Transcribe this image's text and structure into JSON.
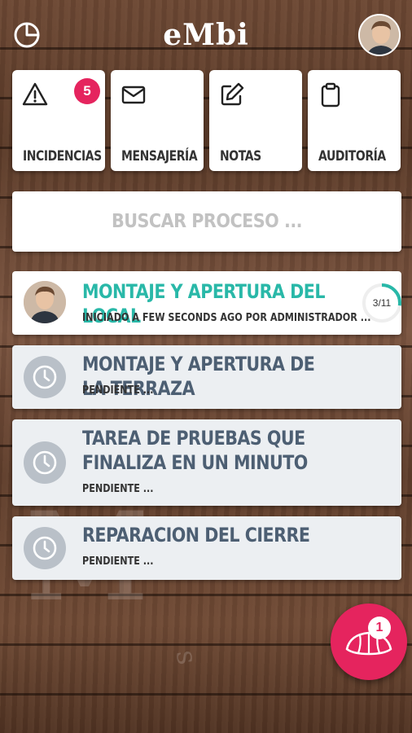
{
  "header": {
    "logo": "eMbi",
    "stats_icon": "pie-chart-icon",
    "avatar": "user-avatar"
  },
  "tiles": [
    {
      "label": "INCIDENCIAS",
      "icon": "warning-icon",
      "badge": "5"
    },
    {
      "label": "MENSAJERÍA",
      "icon": "mail-icon"
    },
    {
      "label": "NOTAS",
      "icon": "edit-icon"
    },
    {
      "label": "AUDITORÍA",
      "icon": "clipboard-icon"
    }
  ],
  "search": {
    "placeholder": "BUSCAR PROCESO ..."
  },
  "processes": [
    {
      "title": "MONTAJE Y APERTURA DEL LOCAL",
      "subtitle": "INICIADO A FEW SECONDS AGO POR ADMINISTRADOR ...",
      "progress": "3/11",
      "progress_value": 0.2727,
      "status": "active"
    },
    {
      "title": "MONTAJE Y APERTURA DE LA TERRAZA",
      "subtitle": "PENDIENTE ...",
      "status": "pending"
    },
    {
      "title": "TAREA DE PRUEBAS QUE FINALIZA EN UN MINUTO",
      "subtitle": "PENDIENTE ...",
      "status": "pending"
    },
    {
      "title": "REPARACION DEL CIERRE",
      "subtitle": "PENDIENTE ...",
      "status": "pending"
    }
  ],
  "fab": {
    "badge": "1",
    "icon": "croissant-icon"
  },
  "colors": {
    "accent": "#e5245e",
    "teal": "#29b8a8",
    "title": "#4d5f73"
  }
}
